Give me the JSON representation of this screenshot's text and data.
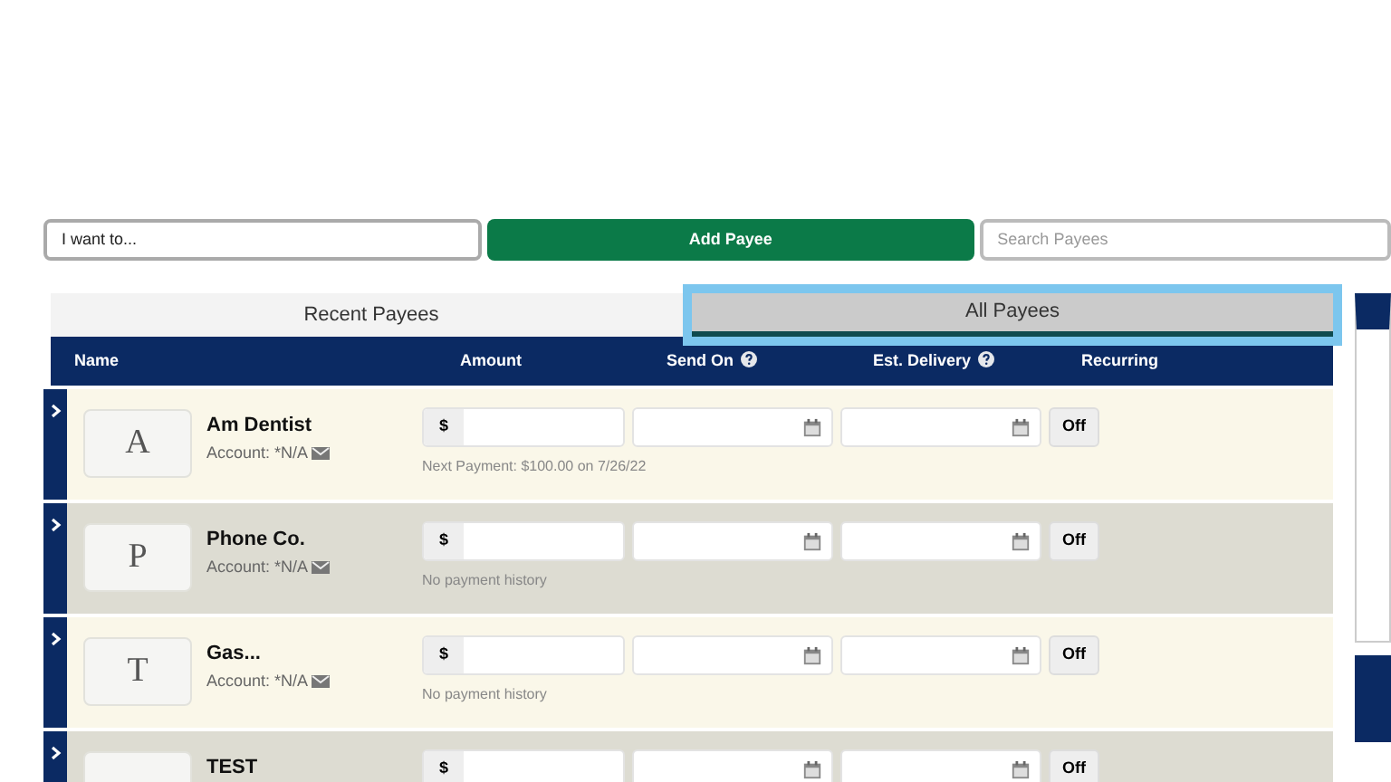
{
  "toolbar": {
    "action_select": "I want to...",
    "add_button": "Add Payee",
    "search": {
      "placeholder": "Search Payees"
    }
  },
  "tabs": [
    {
      "label": "Recent Payees",
      "selected": false
    },
    {
      "label": "All Payees",
      "selected": true
    }
  ],
  "columns": [
    {
      "label": "Name",
      "help": false
    },
    {
      "label": "Amount",
      "help": false
    },
    {
      "label": "Send On",
      "help": true
    },
    {
      "label": "Est. Delivery",
      "help": true
    },
    {
      "label": "Recurring",
      "help": false
    }
  ],
  "payees": [
    {
      "letter": "A",
      "name": "Am Dentist",
      "account": "Account: *N/A",
      "currency": "$",
      "note": "Next Payment: $100.00 on 7/26/22",
      "recurring": "Off"
    },
    {
      "letter": "P",
      "name": "Phone Co.",
      "account": "Account: *N/A",
      "currency": "$",
      "note": "No payment history",
      "recurring": "Off"
    },
    {
      "letter": "T",
      "name": "Gas...",
      "account": "Account: *N/A",
      "currency": "$",
      "note": "No payment history",
      "recurring": "Off"
    },
    {
      "name": "TEST",
      "currency": "$",
      "recurring": "Off"
    }
  ]
}
